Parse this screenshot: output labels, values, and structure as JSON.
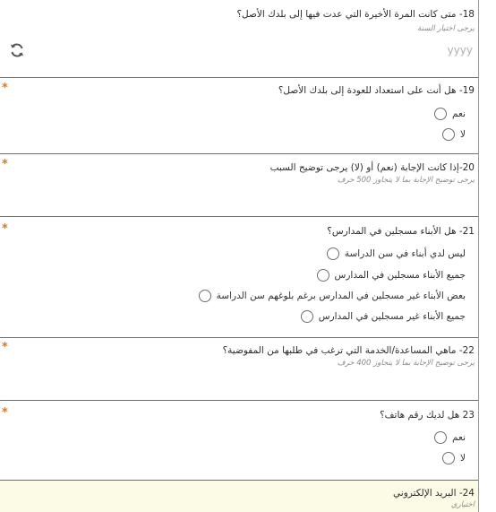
{
  "q18": {
    "title": "18- متى كانت المرة الأخيرة التي عدت فيها إلى بلدك الأصل؟",
    "hint": "يرجى اختيار السنة",
    "placeholder": "yyyy"
  },
  "q19": {
    "title": "19- هل أنت على استعداد للعودة إلى بلدك الأصل؟",
    "options": [
      "نعم",
      "لا"
    ]
  },
  "q20": {
    "title": "20-إذا كانت الإجابة (نعم) أو (لا) يرجى توضيح السبب",
    "hint": "يرجى توضيح الإجابة بما لا يتجاوز 500 حرف"
  },
  "q21": {
    "title": "21- هل الأبناء مسجلين في المدارس؟",
    "options": [
      "ليس لدي أبناء في سن الدراسة",
      "جميع الأبناء مسجلين في المدارس",
      "بعض الأبناء غير مسجلين في المدارس برغم بلوغهم سن الدراسة",
      "جميع الأبناء غير مسجلين في المدارس"
    ]
  },
  "q22": {
    "title": "22- ماهي المساعدة/الخدمة التي ترغب في طلبها من المفوضية؟",
    "hint": "يرجى توضيح الإجابة بما لا يتجاوز 400 حرف"
  },
  "q23": {
    "title": "23 هل لديك رقم هاتف؟",
    "options": [
      "نعم",
      "لا"
    ]
  },
  "q24": {
    "title": "24- البريد الإلكتروني",
    "hint": "اختياري"
  },
  "required_mark": "*",
  "colors": {
    "required": "#e8740c",
    "active_bg": "#fbfbe6",
    "border": "#6e6e6e"
  }
}
